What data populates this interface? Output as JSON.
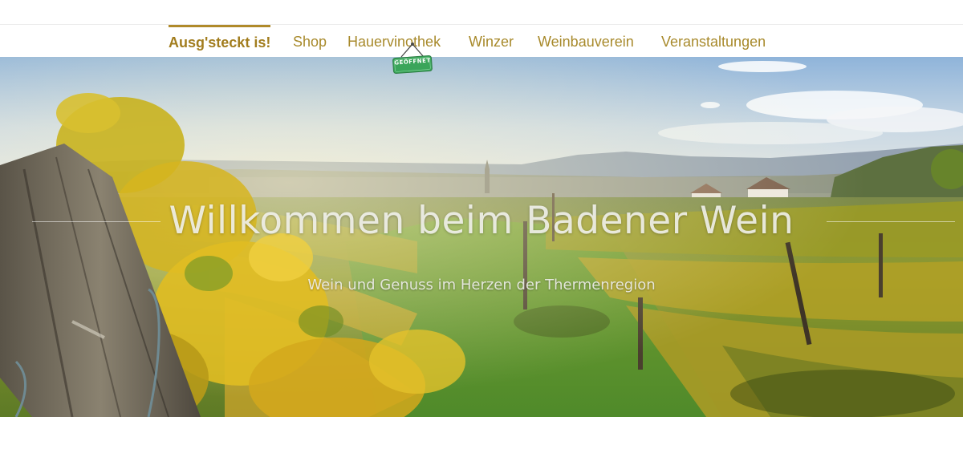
{
  "nav": {
    "items": [
      {
        "label": "Ausg'steckt is!",
        "active": true
      },
      {
        "label": "Shop",
        "active": false
      },
      {
        "label": "Hauervinothek",
        "active": false
      },
      {
        "label": "Winzer",
        "active": false
      },
      {
        "label": "Weinbauverein",
        "active": false
      },
      {
        "label": "Veranstaltungen",
        "active": false
      }
    ],
    "badge": "GEÖFFNET"
  },
  "hero": {
    "title": "Willkommen beim Badener Wein",
    "subtitle": "Wein und Genuss im Herzen der Thermenregion"
  },
  "colors": {
    "nav_text": "#a88a2c",
    "nav_active": "#a27d1e",
    "badge_green": "#3aa55a"
  }
}
